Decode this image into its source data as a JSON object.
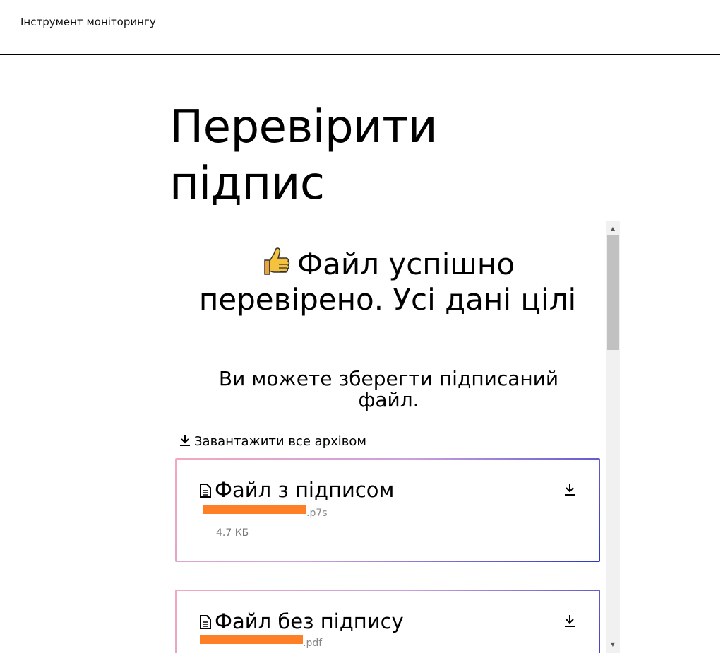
{
  "header": {
    "app_title": "Інструмент моніторингу"
  },
  "page": {
    "title": "Перевірити підпис"
  },
  "result": {
    "emoji": "👍",
    "title": "Файл успішно перевірено. Усі дані цілі",
    "subtitle": "Ви можете зберегти підписаний файл.",
    "download_all_label": "Завантажити все архівом"
  },
  "files": [
    {
      "title": "Файл з підписом",
      "extension": ".p7s",
      "size": "4.7 КБ",
      "name_redacted": true
    },
    {
      "title": "Файл без підпису",
      "extension": ".pdf",
      "name_redacted": true
    }
  ],
  "colors": {
    "redaction": "#ff7f27",
    "card_border_start": "#f3a9bd",
    "card_border_end": "#2b35c7",
    "header_rule": "#000000"
  },
  "icons": {
    "download": "download-icon",
    "document": "document-icon",
    "thumbs_up": "thumbs-up-icon"
  }
}
